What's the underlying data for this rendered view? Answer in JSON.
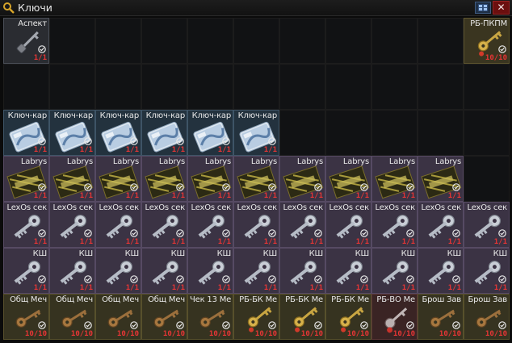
{
  "window": {
    "title": "Ключи",
    "title_icon": "magnifier-key-icon",
    "minimize_icon": "collapse-icon",
    "close_label": "✕"
  },
  "colors": {
    "count_text": "#e53535",
    "title_text": "#e6e6e6"
  },
  "items": [
    {
      "id": "aspect",
      "name": "Аспект",
      "count": "1/1",
      "kind": "key-simple",
      "bg": "grey",
      "col": 1,
      "row": 1,
      "w": 1,
      "h": 1
    },
    {
      "id": "rb-pkpm",
      "name": "РБ-ПКПМ",
      "count": "10/10",
      "kind": "key-gold",
      "bg": "olive",
      "col": 11,
      "row": 1,
      "w": 1,
      "h": 1
    },
    {
      "id": "kc1",
      "name": "Ключ-кар",
      "count": "1/1",
      "kind": "keycard",
      "bg": "blue",
      "col": 1,
      "row": 3,
      "w": 1,
      "h": 1
    },
    {
      "id": "kc2",
      "name": "Ключ-кар",
      "count": "1/1",
      "kind": "keycard",
      "bg": "blue",
      "col": 2,
      "row": 3,
      "w": 1,
      "h": 1
    },
    {
      "id": "kc3",
      "name": "Ключ-кар",
      "count": "1/1",
      "kind": "keycard",
      "bg": "blue",
      "col": 3,
      "row": 3,
      "w": 1,
      "h": 1
    },
    {
      "id": "kc4",
      "name": "Ключ-кар",
      "count": "1/1",
      "kind": "keycard",
      "bg": "blue",
      "col": 4,
      "row": 3,
      "w": 1,
      "h": 1
    },
    {
      "id": "kc5",
      "name": "Ключ-кар",
      "count": "1/1",
      "kind": "keycard",
      "bg": "blue",
      "col": 5,
      "row": 3,
      "w": 1,
      "h": 1
    },
    {
      "id": "kc6",
      "name": "Ключ-кар",
      "count": "1/1",
      "kind": "keycard",
      "bg": "blue",
      "col": 6,
      "row": 3,
      "w": 1,
      "h": 1
    },
    {
      "id": "lab1",
      "name": "Labrys",
      "count": "1/1",
      "kind": "labrys",
      "bg": "violet",
      "col": 1,
      "row": 4,
      "w": 1,
      "h": 1
    },
    {
      "id": "lab2",
      "name": "Labrys",
      "count": "1/1",
      "kind": "labrys",
      "bg": "violet",
      "col": 2,
      "row": 4,
      "w": 1,
      "h": 1
    },
    {
      "id": "lab3",
      "name": "Labrys",
      "count": "1/1",
      "kind": "labrys",
      "bg": "violet",
      "col": 3,
      "row": 4,
      "w": 1,
      "h": 1
    },
    {
      "id": "lab4",
      "name": "Labrys",
      "count": "1/1",
      "kind": "labrys",
      "bg": "violet",
      "col": 4,
      "row": 4,
      "w": 1,
      "h": 1
    },
    {
      "id": "lab5",
      "name": "Labrys",
      "count": "1/1",
      "kind": "labrys",
      "bg": "violet",
      "col": 5,
      "row": 4,
      "w": 1,
      "h": 1
    },
    {
      "id": "lab6",
      "name": "Labrys",
      "count": "1/1",
      "kind": "labrys",
      "bg": "violet",
      "col": 6,
      "row": 4,
      "w": 1,
      "h": 1
    },
    {
      "id": "lab7",
      "name": "Labrys",
      "count": "1/1",
      "kind": "labrys",
      "bg": "violet",
      "col": 7,
      "row": 4,
      "w": 1,
      "h": 1
    },
    {
      "id": "lab8",
      "name": "Labrys",
      "count": "1/1",
      "kind": "labrys",
      "bg": "violet",
      "col": 8,
      "row": 4,
      "w": 1,
      "h": 1
    },
    {
      "id": "lab9",
      "name": "Labrys",
      "count": "1/1",
      "kind": "labrys",
      "bg": "violet",
      "col": 9,
      "row": 4,
      "w": 1,
      "h": 1
    },
    {
      "id": "lab10",
      "name": "Labrys",
      "count": "1/1",
      "kind": "labrys",
      "bg": "violet",
      "col": 10,
      "row": 4,
      "w": 1,
      "h": 1
    },
    {
      "id": "lx1",
      "name": "LexOs сек",
      "count": "1/1",
      "kind": "key-silver",
      "bg": "violet",
      "col": 1,
      "row": 5,
      "w": 1,
      "h": 1
    },
    {
      "id": "lx2",
      "name": "LexOs сек",
      "count": "1/1",
      "kind": "key-silver",
      "bg": "violet",
      "col": 2,
      "row": 5,
      "w": 1,
      "h": 1
    },
    {
      "id": "lx3",
      "name": "LexOs сек",
      "count": "1/1",
      "kind": "key-silver",
      "bg": "violet",
      "col": 3,
      "row": 5,
      "w": 1,
      "h": 1
    },
    {
      "id": "lx4",
      "name": "LexOs сек",
      "count": "1/1",
      "kind": "key-silver",
      "bg": "violet",
      "col": 4,
      "row": 5,
      "w": 1,
      "h": 1
    },
    {
      "id": "lx5",
      "name": "LexOs сек",
      "count": "1/1",
      "kind": "key-silver",
      "bg": "violet",
      "col": 5,
      "row": 5,
      "w": 1,
      "h": 1
    },
    {
      "id": "lx6",
      "name": "LexOs сек",
      "count": "1/1",
      "kind": "key-silver",
      "bg": "violet",
      "col": 6,
      "row": 5,
      "w": 1,
      "h": 1
    },
    {
      "id": "lx7",
      "name": "LexOs сек",
      "count": "1/1",
      "kind": "key-silver",
      "bg": "violet",
      "col": 7,
      "row": 5,
      "w": 1,
      "h": 1
    },
    {
      "id": "lx8",
      "name": "LexOs сек",
      "count": "1/1",
      "kind": "key-silver",
      "bg": "violet",
      "col": 8,
      "row": 5,
      "w": 1,
      "h": 1
    },
    {
      "id": "lx9",
      "name": "LexOs сек",
      "count": "1/1",
      "kind": "key-silver",
      "bg": "violet",
      "col": 9,
      "row": 5,
      "w": 1,
      "h": 1
    },
    {
      "id": "lx10",
      "name": "LexOs сек",
      "count": "1/1",
      "kind": "key-silver",
      "bg": "violet",
      "col": 10,
      "row": 5,
      "w": 1,
      "h": 1
    },
    {
      "id": "lx11",
      "name": "LexOs сек",
      "count": "1/1",
      "kind": "key-silver",
      "bg": "violet",
      "col": 11,
      "row": 5,
      "w": 1,
      "h": 1
    },
    {
      "id": "ksh1",
      "name": "КШ",
      "count": "1/1",
      "kind": "key-silver",
      "bg": "violet",
      "col": 1,
      "row": 6,
      "w": 1,
      "h": 1
    },
    {
      "id": "ksh2",
      "name": "КШ",
      "count": "1/1",
      "kind": "key-silver",
      "bg": "violet",
      "col": 2,
      "row": 6,
      "w": 1,
      "h": 1
    },
    {
      "id": "ksh3",
      "name": "КШ",
      "count": "1/1",
      "kind": "key-silver",
      "bg": "violet",
      "col": 3,
      "row": 6,
      "w": 1,
      "h": 1
    },
    {
      "id": "ksh4",
      "name": "КШ",
      "count": "1/1",
      "kind": "key-silver",
      "bg": "violet",
      "col": 4,
      "row": 6,
      "w": 1,
      "h": 1
    },
    {
      "id": "ksh5",
      "name": "КШ",
      "count": "1/1",
      "kind": "key-silver",
      "bg": "violet",
      "col": 5,
      "row": 6,
      "w": 1,
      "h": 1
    },
    {
      "id": "ksh6",
      "name": "КШ",
      "count": "1/1",
      "kind": "key-silver",
      "bg": "violet",
      "col": 6,
      "row": 6,
      "w": 1,
      "h": 1
    },
    {
      "id": "ksh7",
      "name": "КШ",
      "count": "1/1",
      "kind": "key-silver",
      "bg": "violet",
      "col": 7,
      "row": 6,
      "w": 1,
      "h": 1
    },
    {
      "id": "ksh8",
      "name": "КШ",
      "count": "1/1",
      "kind": "key-silver",
      "bg": "violet",
      "col": 8,
      "row": 6,
      "w": 1,
      "h": 1
    },
    {
      "id": "ksh9",
      "name": "КШ",
      "count": "1/1",
      "kind": "key-silver",
      "bg": "violet",
      "col": 9,
      "row": 6,
      "w": 1,
      "h": 1
    },
    {
      "id": "ksh10",
      "name": "КШ",
      "count": "1/1",
      "kind": "key-silver",
      "bg": "violet",
      "col": 10,
      "row": 6,
      "w": 1,
      "h": 1
    },
    {
      "id": "ksh11",
      "name": "КШ",
      "count": "1/1",
      "kind": "key-silver",
      "bg": "violet",
      "col": 11,
      "row": 6,
      "w": 1,
      "h": 1
    },
    {
      "id": "ob1",
      "name": "Общ Меч",
      "count": "10/10",
      "kind": "key-bronze",
      "bg": "olive2",
      "col": 1,
      "row": 7,
      "w": 1,
      "h": 1
    },
    {
      "id": "ob2",
      "name": "Общ Меч",
      "count": "10/10",
      "kind": "key-bronze",
      "bg": "olive2",
      "col": 2,
      "row": 7,
      "w": 1,
      "h": 1
    },
    {
      "id": "ob3",
      "name": "Общ Меч",
      "count": "10/10",
      "kind": "key-bronze",
      "bg": "olive2",
      "col": 3,
      "row": 7,
      "w": 1,
      "h": 1
    },
    {
      "id": "ob4",
      "name": "Общ Меч",
      "count": "10/10",
      "kind": "key-bronze",
      "bg": "olive2",
      "col": 4,
      "row": 7,
      "w": 1,
      "h": 1
    },
    {
      "id": "ch13",
      "name": "Чек 13 Ме",
      "count": "10/10",
      "kind": "key-bronze",
      "bg": "olive2",
      "col": 5,
      "row": 7,
      "w": 1,
      "h": 1
    },
    {
      "id": "rbbk1",
      "name": "РБ-БК Ме",
      "count": "10/10",
      "kind": "key-gold",
      "bg": "olive2",
      "col": 6,
      "row": 7,
      "w": 1,
      "h": 1
    },
    {
      "id": "rbbk2",
      "name": "РБ-БК Ме",
      "count": "10/10",
      "kind": "key-gold",
      "bg": "olive2",
      "col": 7,
      "row": 7,
      "w": 1,
      "h": 1
    },
    {
      "id": "rbbk3",
      "name": "РБ-БК Ме",
      "count": "10/10",
      "kind": "key-gold",
      "bg": "olive2",
      "col": 8,
      "row": 7,
      "w": 1,
      "h": 1
    },
    {
      "id": "rbvo",
      "name": "РБ-ВО Ме",
      "count": "10/10",
      "kind": "key-red",
      "bg": "red",
      "col": 9,
      "row": 7,
      "w": 1,
      "h": 1
    },
    {
      "id": "brosh1",
      "name": "Брош Зав",
      "count": "10/10",
      "kind": "key-bronze",
      "bg": "olive2",
      "col": 10,
      "row": 7,
      "w": 1,
      "h": 1
    },
    {
      "id": "brosh2",
      "name": "Брош Зав",
      "count": "10/10",
      "kind": "key-bronze",
      "bg": "olive2",
      "col": 11,
      "row": 7,
      "w": 1,
      "h": 1
    }
  ]
}
